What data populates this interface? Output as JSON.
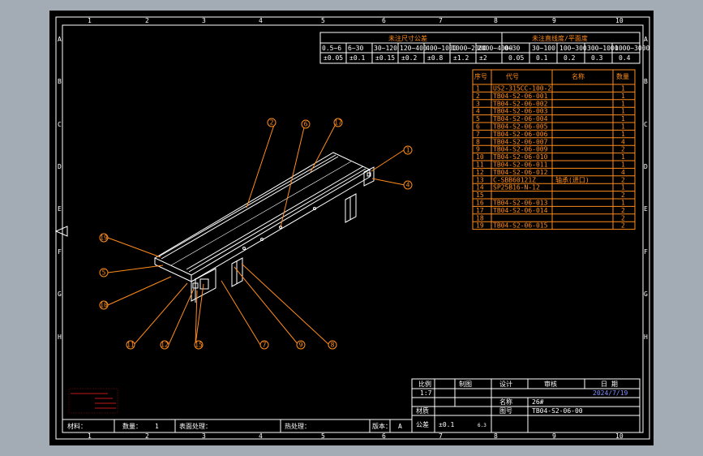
{
  "col_numbers": [
    "1",
    "2",
    "3",
    "4",
    "5",
    "6",
    "7",
    "8",
    "9",
    "10"
  ],
  "row_letters": [
    "A",
    "B",
    "C",
    "D",
    "E",
    "F",
    "G",
    "H"
  ],
  "tolerance_table": {
    "title_left": "未注尺寸公差",
    "title_right": "未注直线度/平面度",
    "ranges_left": [
      "0.5~6",
      "6~30",
      "30~120",
      "120~400",
      "400~1000",
      "1000~2000",
      "2000~4000"
    ],
    "values_left": [
      "±0.05",
      "±0.1",
      "±0.15",
      "±0.2",
      "±0.8",
      "±1.2",
      "±2"
    ],
    "ranges_right": [
      "0~30",
      "30~100",
      "100~300",
      "300~1000",
      "1000~3000"
    ],
    "values_right": [
      "0.05",
      "0.1",
      "0.2",
      "0.3",
      "0.4"
    ]
  },
  "bom": {
    "headers": [
      "序号",
      "代号",
      "名称",
      "数量"
    ],
    "rows": [
      {
        "no": "1",
        "code": "US2-315CC-100-2",
        "name": "",
        "qty": "1"
      },
      {
        "no": "2",
        "code": "TB04-S2-06-001",
        "name": "",
        "qty": "1"
      },
      {
        "no": "3",
        "code": "TB04-S2-06-002",
        "name": "",
        "qty": "1"
      },
      {
        "no": "4",
        "code": "TB04-S2-06-003",
        "name": "",
        "qty": "1"
      },
      {
        "no": "5",
        "code": "TB04-S2-06-004",
        "name": "",
        "qty": "1"
      },
      {
        "no": "6",
        "code": "TB04-S2-06-005",
        "name": "",
        "qty": "1"
      },
      {
        "no": "7",
        "code": "TB04-S2-06-006",
        "name": "",
        "qty": "1"
      },
      {
        "no": "8",
        "code": "TB04-S2-06-007",
        "name": "",
        "qty": "4"
      },
      {
        "no": "9",
        "code": "TB04-S2-06-009",
        "name": "",
        "qty": "2"
      },
      {
        "no": "10",
        "code": "TB04-S2-06-010",
        "name": "",
        "qty": "1"
      },
      {
        "no": "11",
        "code": "TB04-S2-06-011",
        "name": "",
        "qty": "1"
      },
      {
        "no": "12",
        "code": "TB04-S2-06-012",
        "name": "",
        "qty": "4"
      },
      {
        "no": "13",
        "code": "C-SBB60121Z",
        "name": "轴承(进口)",
        "qty": "2"
      },
      {
        "no": "14",
        "code": "SP25B16-N-12",
        "name": "",
        "qty": "1"
      },
      {
        "no": "15",
        "code": "",
        "name": "",
        "qty": "2"
      },
      {
        "no": "16",
        "code": "TB04-S2-06-013",
        "name": "",
        "qty": "1"
      },
      {
        "no": "17",
        "code": "TB04-S2-06-014",
        "name": "",
        "qty": "2"
      },
      {
        "no": "18",
        "code": "",
        "name": "",
        "qty": "2"
      },
      {
        "no": "19",
        "code": "TB04-S2-06-015",
        "name": "",
        "qty": "2"
      }
    ]
  },
  "balloons": [
    "1",
    "2",
    "3",
    "4",
    "5",
    "6",
    "7",
    "8",
    "9",
    "10",
    "11",
    "12",
    "13",
    "14",
    "15",
    "16",
    "17",
    "18",
    "19"
  ],
  "title_block": {
    "h_scale": "比例",
    "h_draw": "制图",
    "h_design": "设计",
    "h_review": "审核",
    "h_date": "日 期",
    "scale": "1:7",
    "date": "2024/7/19",
    "h_name": "名称",
    "name": "26#",
    "h_material": "材质",
    "h_code": "图号",
    "code": "TB04-S2-06-00",
    "h_tolerance": "公差",
    "tolerance": "±0.1",
    "roughness": "6.3",
    "h_material2": "材料：",
    "h_qty": "数量：",
    "qty": "1",
    "h_surface": "表面处理：",
    "h_heat": "热处理：",
    "h_rev": "版本：",
    "rev": "A"
  },
  "colors": {
    "sheet": "#000000",
    "frame": "#ffffff",
    "annot": "#ff8c1a",
    "note": "#ff2020",
    "background": "#a3acb4"
  }
}
